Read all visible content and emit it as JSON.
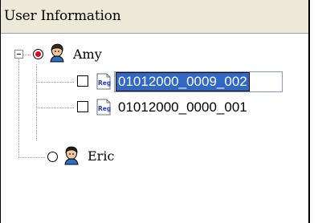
{
  "header": {
    "title": "User Information"
  },
  "tree": {
    "nodes": [
      {
        "name": "Amy",
        "selected": true,
        "expanded": true,
        "children": [
          {
            "label": "01012000_0009_002",
            "checked": false,
            "editing": true
          },
          {
            "label": "01012000_0000_001",
            "checked": false,
            "editing": false
          }
        ]
      },
      {
        "name": "Eric",
        "selected": false,
        "expanded": false,
        "children": []
      }
    ]
  },
  "icons": {
    "user": "user-head-icon",
    "registration": "reg-document-icon",
    "expander": "minus-icon"
  },
  "colors": {
    "selection": "#3168c6",
    "radio_selected": "#e8001c",
    "header_bg": "#ece9d8"
  }
}
